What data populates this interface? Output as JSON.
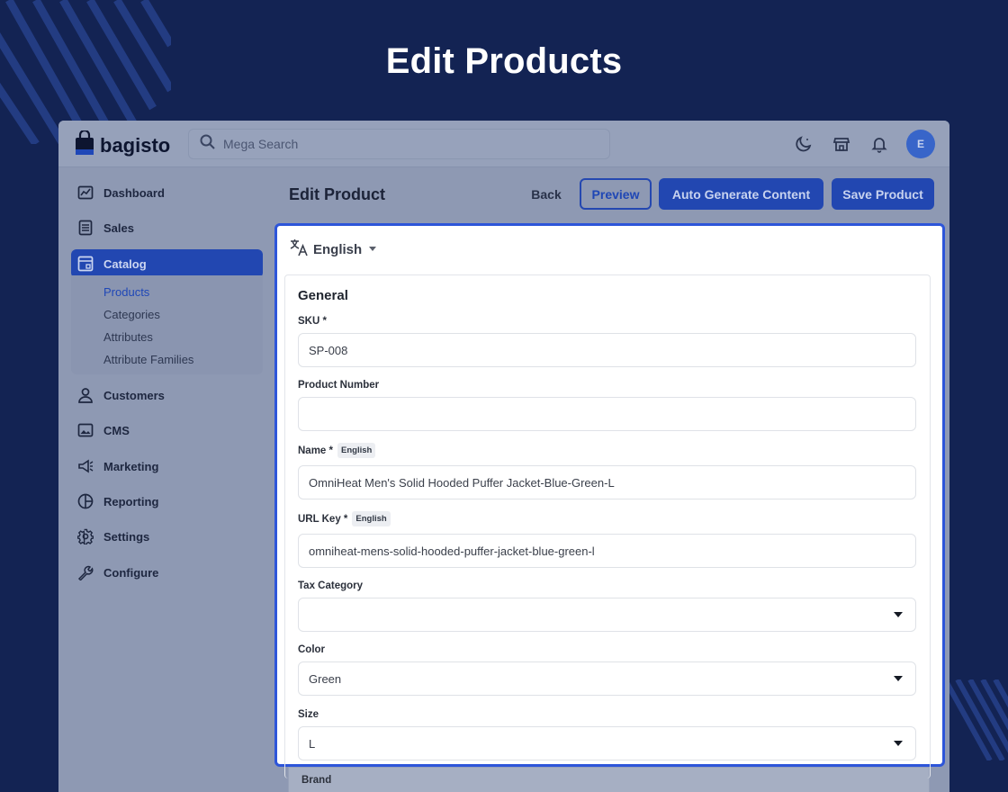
{
  "banner": {
    "title": "Edit Products"
  },
  "app": {
    "logo_text": "bagisto",
    "avatar_initial": "E"
  },
  "search": {
    "placeholder": "Mega Search"
  },
  "sidebar": {
    "items": [
      {
        "label": "Dashboard",
        "icon": "dashboard-icon"
      },
      {
        "label": "Sales",
        "icon": "sales-icon"
      },
      {
        "label": "Catalog",
        "icon": "catalog-icon",
        "active": true
      },
      {
        "label": "Customers",
        "icon": "customers-icon"
      },
      {
        "label": "CMS",
        "icon": "cms-icon"
      },
      {
        "label": "Marketing",
        "icon": "marketing-icon"
      },
      {
        "label": "Reporting",
        "icon": "reporting-icon"
      },
      {
        "label": "Settings",
        "icon": "settings-icon"
      },
      {
        "label": "Configure",
        "icon": "configure-icon"
      }
    ],
    "catalog_sub": [
      "Products",
      "Categories",
      "Attributes",
      "Attribute Families"
    ]
  },
  "header": {
    "title": "Edit Product",
    "back_label": "Back",
    "preview_label": "Preview",
    "auto_generate_label": "Auto Generate Content",
    "save_label": "Save Product"
  },
  "locale": {
    "selected": "English"
  },
  "general": {
    "title": "General",
    "sku": {
      "label": "SKU *",
      "value": "SP-008"
    },
    "product_number": {
      "label": "Product Number",
      "value": ""
    },
    "name": {
      "label": "Name *",
      "badge": "English",
      "value": "OmniHeat Men's Solid Hooded Puffer Jacket-Blue-Green-L"
    },
    "url_key": {
      "label": "URL Key *",
      "badge": "English",
      "value": "omniheat-mens-solid-hooded-puffer-jacket-blue-green-l"
    },
    "tax_category": {
      "label": "Tax Category",
      "value": ""
    },
    "color": {
      "label": "Color",
      "value": "Green"
    },
    "size": {
      "label": "Size",
      "value": "L"
    },
    "brand": {
      "label": "Brand"
    }
  },
  "colors": {
    "background": "#132353",
    "accent": "#2247b1",
    "highlight_border": "#2d55d9"
  }
}
